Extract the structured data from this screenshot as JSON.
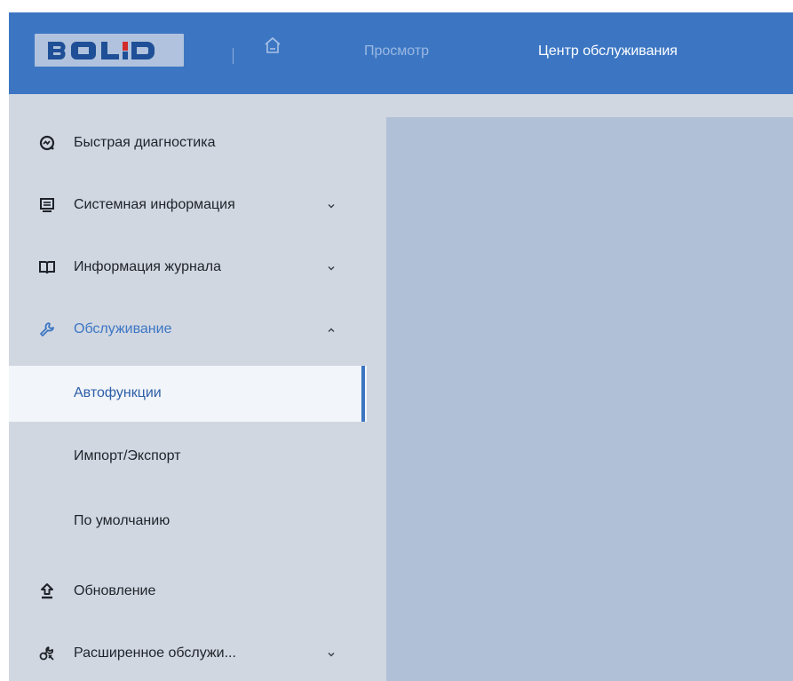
{
  "header": {
    "logo_text": "BOLID",
    "logo_icon": "bolid-logo",
    "home_icon": "home-icon",
    "nav": [
      {
        "label": "Просмотр"
      },
      {
        "label": "Центр обслуживания"
      }
    ],
    "colors": {
      "bar": "#3c76c3",
      "logo_plate": "#b0c2dd",
      "inactive_nav": "#9ab8e2",
      "active_nav": "#ffffff"
    }
  },
  "sidebar": {
    "items": [
      {
        "label": "Быстрая диагностика",
        "icon": "diagnostics-icon"
      },
      {
        "label": "Системная информация",
        "icon": "monitor-icon",
        "arrow": "chevron-down-icon"
      },
      {
        "label": "Информация журнала",
        "icon": "book-icon",
        "arrow": "chevron-down-icon"
      },
      {
        "label": "Обслуживание",
        "icon": "wrench-icon",
        "arrow": "chevron-up-icon"
      },
      {
        "label": "Автофункции"
      },
      {
        "label": "Импорт/Экспорт"
      },
      {
        "label": "По умолчанию"
      },
      {
        "label": "Обновление",
        "icon": "upload-icon"
      },
      {
        "label": "Расширенное обслужи...",
        "icon": "advanced-icon",
        "arrow": "chevron-down-icon"
      }
    ],
    "active_item": "Автофункции",
    "colors": {
      "background": "#d1d7e1",
      "active_bg": "#f2f5f9",
      "accent": "#3c76c3"
    }
  },
  "content": {
    "colors": {
      "panel": "#b0c0d7"
    }
  }
}
